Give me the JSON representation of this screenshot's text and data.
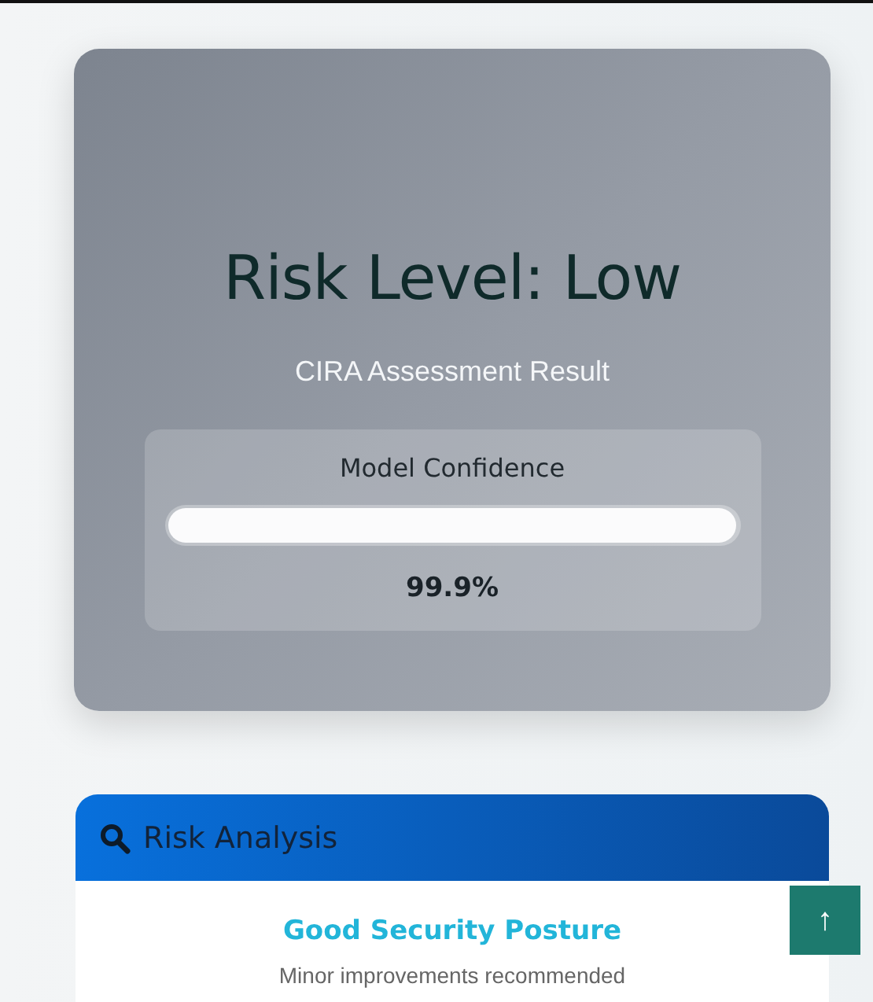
{
  "risk_card": {
    "title": "Risk Level: Low",
    "subtitle": "CIRA Assessment Result",
    "confidence": {
      "label": "Model Confidence",
      "level": 0.999,
      "reading": "99.9%"
    }
  },
  "analysis_card": {
    "title": "Risk Analysis",
    "headline": "Good Security Posture",
    "note": "Minor improvements recommended"
  },
  "scroll_top_button": {
    "label": "↑"
  }
}
